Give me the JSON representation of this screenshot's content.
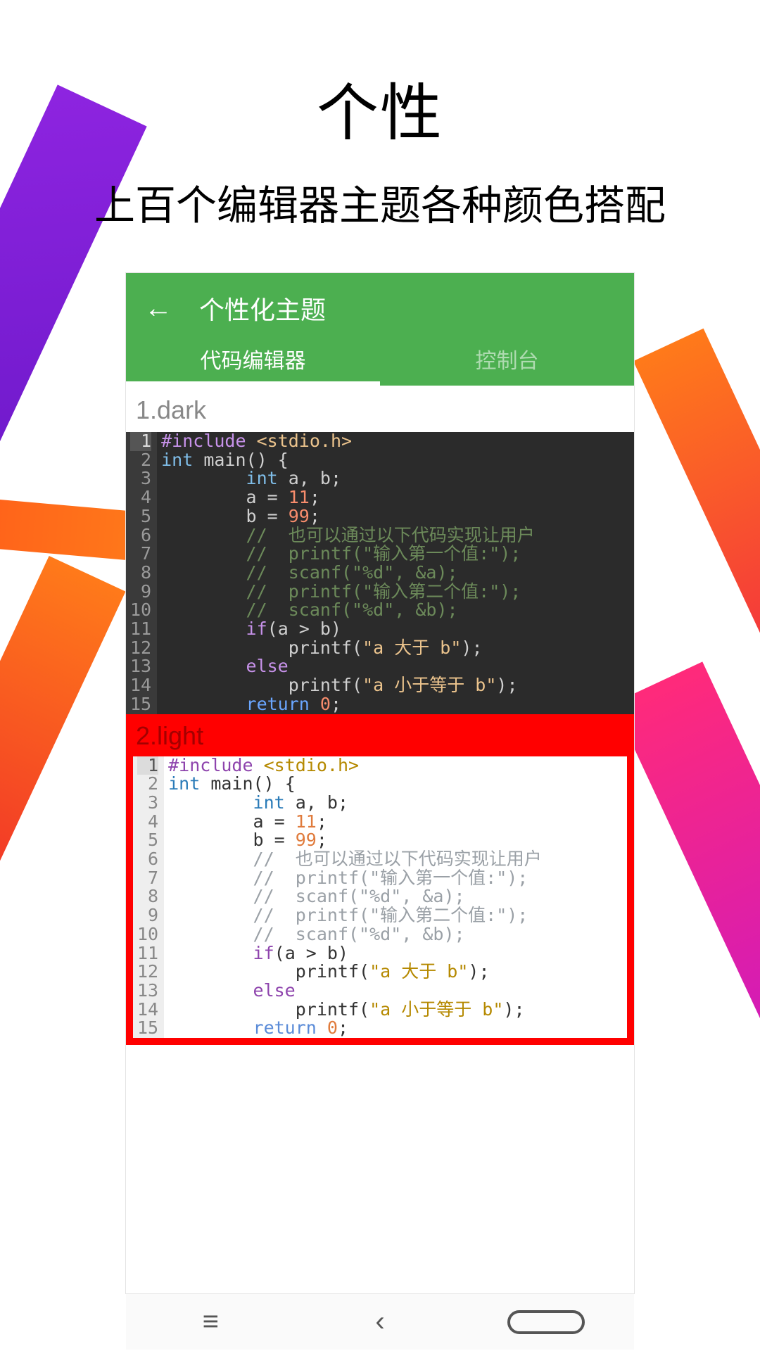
{
  "heading": {
    "title": "个性",
    "subtitle": "上百个编辑器主题各种颜色搭配"
  },
  "appbar": {
    "title": "个性化主题",
    "tabs": [
      {
        "label": "代码编辑器",
        "active": true
      },
      {
        "label": "控制台",
        "active": false
      }
    ]
  },
  "themes": [
    {
      "name": "1.dark",
      "variant": "dark"
    },
    {
      "name": "2.light",
      "variant": "light"
    }
  ],
  "code_lines": [
    {
      "n": 1,
      "html": "<span class='inc'>#include</span> <span class='hdr'>&lt;stdio.h&gt;</span>"
    },
    {
      "n": 2,
      "html": "<span class='ty'>int</span> <span class='fn'>main</span>() {"
    },
    {
      "n": 3,
      "html": "        <span class='ty'>int</span> a, b;"
    },
    {
      "n": 4,
      "html": "        a = <span class='num'>11</span>;"
    },
    {
      "n": 5,
      "html": "        b = <span class='num'>99</span>;"
    },
    {
      "n": 6,
      "html": "        <span class='cm'>//  也可以通过以下代码实现让用户</span>"
    },
    {
      "n": 7,
      "html": "        <span class='cm'>//  printf(\"输入第一个值:\");</span>"
    },
    {
      "n": 8,
      "html": "        <span class='cm'>//  scanf(\"%d\", &amp;a);</span>"
    },
    {
      "n": 9,
      "html": "        <span class='cm'>//  printf(\"输入第二个值:\");</span>"
    },
    {
      "n": 10,
      "html": "        <span class='cm'>//  scanf(\"%d\", &amp;b);</span>"
    },
    {
      "n": 11,
      "html": "        <span class='kw'>if</span>(a &gt; b)"
    },
    {
      "n": 12,
      "html": "            printf(<span class='str'>\"a 大于 b\"</span>);"
    },
    {
      "n": 13,
      "html": "        <span class='kw'>else</span>"
    },
    {
      "n": 14,
      "html": "            printf(<span class='str'>\"a 小于等于 b\"</span>);"
    },
    {
      "n": 15,
      "html": "        <span class='kw2'>return</span> <span class='num'>0</span>;"
    }
  ]
}
